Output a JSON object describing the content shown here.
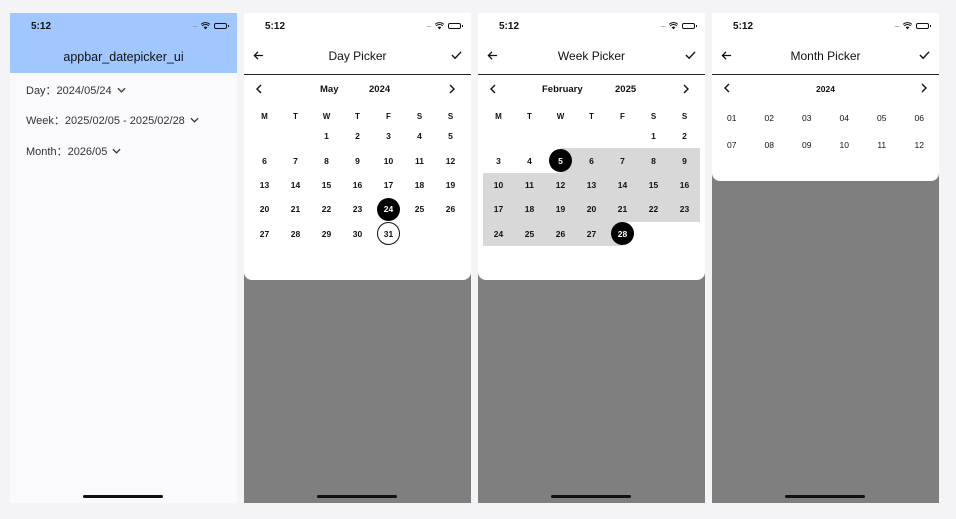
{
  "status": {
    "time": "5:12",
    "dots": "....",
    "wifi_icon": "wifi-icon",
    "battery_icon": "battery-icon"
  },
  "screen1": {
    "title": "appbar_datepicker_ui",
    "appbar_color": "#a0c7ff",
    "fields": [
      {
        "label": "Day：2024/05/24"
      },
      {
        "label": "Week：2025/02/05 - 2025/02/28"
      },
      {
        "label": "Month：2026/05"
      }
    ]
  },
  "day_picker": {
    "title": "Day Picker",
    "month": "May",
    "year": "2024",
    "weekdays": [
      "M",
      "T",
      "W",
      "T",
      "F",
      "S",
      "S"
    ],
    "leading_blanks": 2,
    "days": [
      "1",
      "2",
      "3",
      "4",
      "5",
      "6",
      "7",
      "8",
      "9",
      "10",
      "11",
      "12",
      "13",
      "14",
      "15",
      "16",
      "17",
      "18",
      "19",
      "20",
      "21",
      "22",
      "23",
      "24",
      "25",
      "26",
      "27",
      "28",
      "29",
      "30",
      "31"
    ],
    "selected": "24",
    "today": "31"
  },
  "week_picker": {
    "title": "Week Picker",
    "month": "February",
    "year": "2025",
    "weekdays": [
      "M",
      "T",
      "W",
      "T",
      "F",
      "S",
      "S"
    ],
    "leading_blanks": 5,
    "days": [
      "1",
      "2",
      "3",
      "4",
      "5",
      "6",
      "7",
      "8",
      "9",
      "10",
      "11",
      "12",
      "13",
      "14",
      "15",
      "16",
      "17",
      "18",
      "19",
      "20",
      "21",
      "22",
      "23",
      "24",
      "25",
      "26",
      "27",
      "28"
    ],
    "range_start": "5",
    "range_end": "28"
  },
  "month_picker": {
    "title": "Month Picker",
    "year": "2024",
    "months": [
      "01",
      "02",
      "03",
      "04",
      "05",
      "06",
      "07",
      "08",
      "09",
      "10",
      "11",
      "12"
    ]
  },
  "colors": {
    "selected_bg": "#000000",
    "range_bg": "#d8d8d8",
    "overlay": "#7f7f7f"
  }
}
